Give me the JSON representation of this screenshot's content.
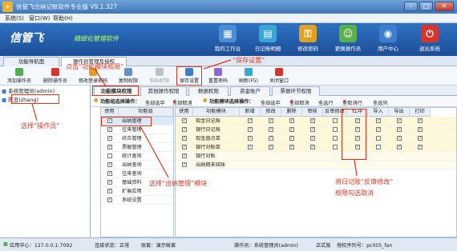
{
  "window": {
    "title": "信管飞出纳记账软件专业版 V9.1.327",
    "icon": "app-icon",
    "min": "–",
    "max": "□",
    "close": "✕"
  },
  "menu": [
    "系统(S)",
    "窗口(W)",
    "帮助(H)"
  ],
  "banner": {
    "logo": "信管飞",
    "slogan": "精细化管理软件"
  },
  "toolbar": [
    {
      "label": "我的工作台",
      "icon": "desk-icon",
      "color": "#4a8fd6"
    },
    {
      "label": "日记账明细",
      "icon": "ledger-icon",
      "color": "#3aa6d8"
    },
    {
      "label": "修改密码",
      "icon": "key-icon",
      "color": "#e2a021"
    },
    {
      "label": "更换操作员",
      "icon": "user-switch-icon",
      "color": "#5ab04a"
    },
    {
      "label": "用户中心",
      "icon": "user-center-icon",
      "color": "#3c7fd0"
    },
    {
      "label": "退出系统",
      "icon": "power-icon",
      "color": "#d9342b"
    }
  ],
  "tabs": [
    "功能导航面",
    "操作员管理及授权"
  ],
  "subtoolbar": [
    "添加操作员",
    "删除操作员",
    "修改登录密码",
    "复制权限",
    "粘贴权限",
    "保存设置",
    "重置密码",
    "刷新(F5)",
    "关闭窗口"
  ],
  "operators": [
    "系统管理员(admin)",
    "陈丑(zhang)"
  ],
  "subtabs": [
    "功能模块权限",
    "其他操作权限",
    "数据权限",
    "资金账户",
    "票据环节权限"
  ],
  "selbar": {
    "left_title": "功能组选择操作：",
    "all_select": "全部选中",
    "all_cancel": "全部取消",
    "right_title": "功能模块选择操作：",
    "all_row": "全选行",
    "all_row_cancel": "全取消行",
    "all_col": "全选列"
  },
  "group_headers": [
    "使用",
    "功能组"
  ],
  "groups": [
    {
      "name": "出纳管理",
      "checked": true
    },
    {
      "name": "往来管理",
      "checked": true
    },
    {
      "name": "综合管理",
      "checked": true
    },
    {
      "name": "票据管理",
      "checked": true
    },
    {
      "name": "统计查询",
      "checked": false
    },
    {
      "name": "出纳查询",
      "checked": true
    },
    {
      "name": "往来查询",
      "checked": true
    },
    {
      "name": "基础资料",
      "checked": true
    },
    {
      "name": "扩展应用",
      "checked": true
    },
    {
      "name": "系统设置",
      "checked": true
    }
  ],
  "module_headers": [
    "使用",
    "功能模块",
    "新增",
    "修改",
    "删除",
    "审核",
    "反审修改",
    "红冲",
    "导入",
    "导出",
    "打印"
  ],
  "modules": [
    {
      "name": "现金日记账",
      "perms": [
        true,
        true,
        true,
        true,
        true,
        false,
        true,
        true,
        true,
        true
      ]
    },
    {
      "name": "银行日记账",
      "perms": [
        true,
        true,
        true,
        true,
        true,
        false,
        true,
        true,
        true,
        true
      ]
    },
    {
      "name": "现金盘点单",
      "perms": [
        true,
        true,
        true,
        true,
        true,
        false,
        true,
        false,
        true,
        true
      ]
    },
    {
      "name": "银行对账单",
      "perms": [
        true,
        true,
        true,
        true,
        true,
        false,
        true,
        false,
        true,
        true
      ]
    },
    {
      "name": "银行对账",
      "perms": [
        true,
        false,
        false,
        false,
        false,
        false,
        false,
        false,
        false,
        false
      ]
    },
    {
      "name": "出纳期末结账",
      "perms": [
        true,
        false,
        false,
        false,
        false,
        false,
        false,
        false,
        false,
        false
      ]
    }
  ],
  "annotations": {
    "save": "“保存设置”",
    "module": "点击“功能模块权限”",
    "operator": "选择“操作员”",
    "cashier": "选择“出纳管理”模块",
    "reverse": "将日记账“反审修改”",
    "reverse2": "权限勾选取消"
  },
  "status": {
    "center": "应用中心：127.0.0.1:7092",
    "conn": "连接状态：正常",
    "book": "账套：演示帐套",
    "operator": "操作员：系统管理员(admin)",
    "edition": "正式版",
    "license": "授权序列号：pc005_fan"
  },
  "colors": {
    "accent_red": "#e8331c",
    "banner": "#1d4f98"
  }
}
